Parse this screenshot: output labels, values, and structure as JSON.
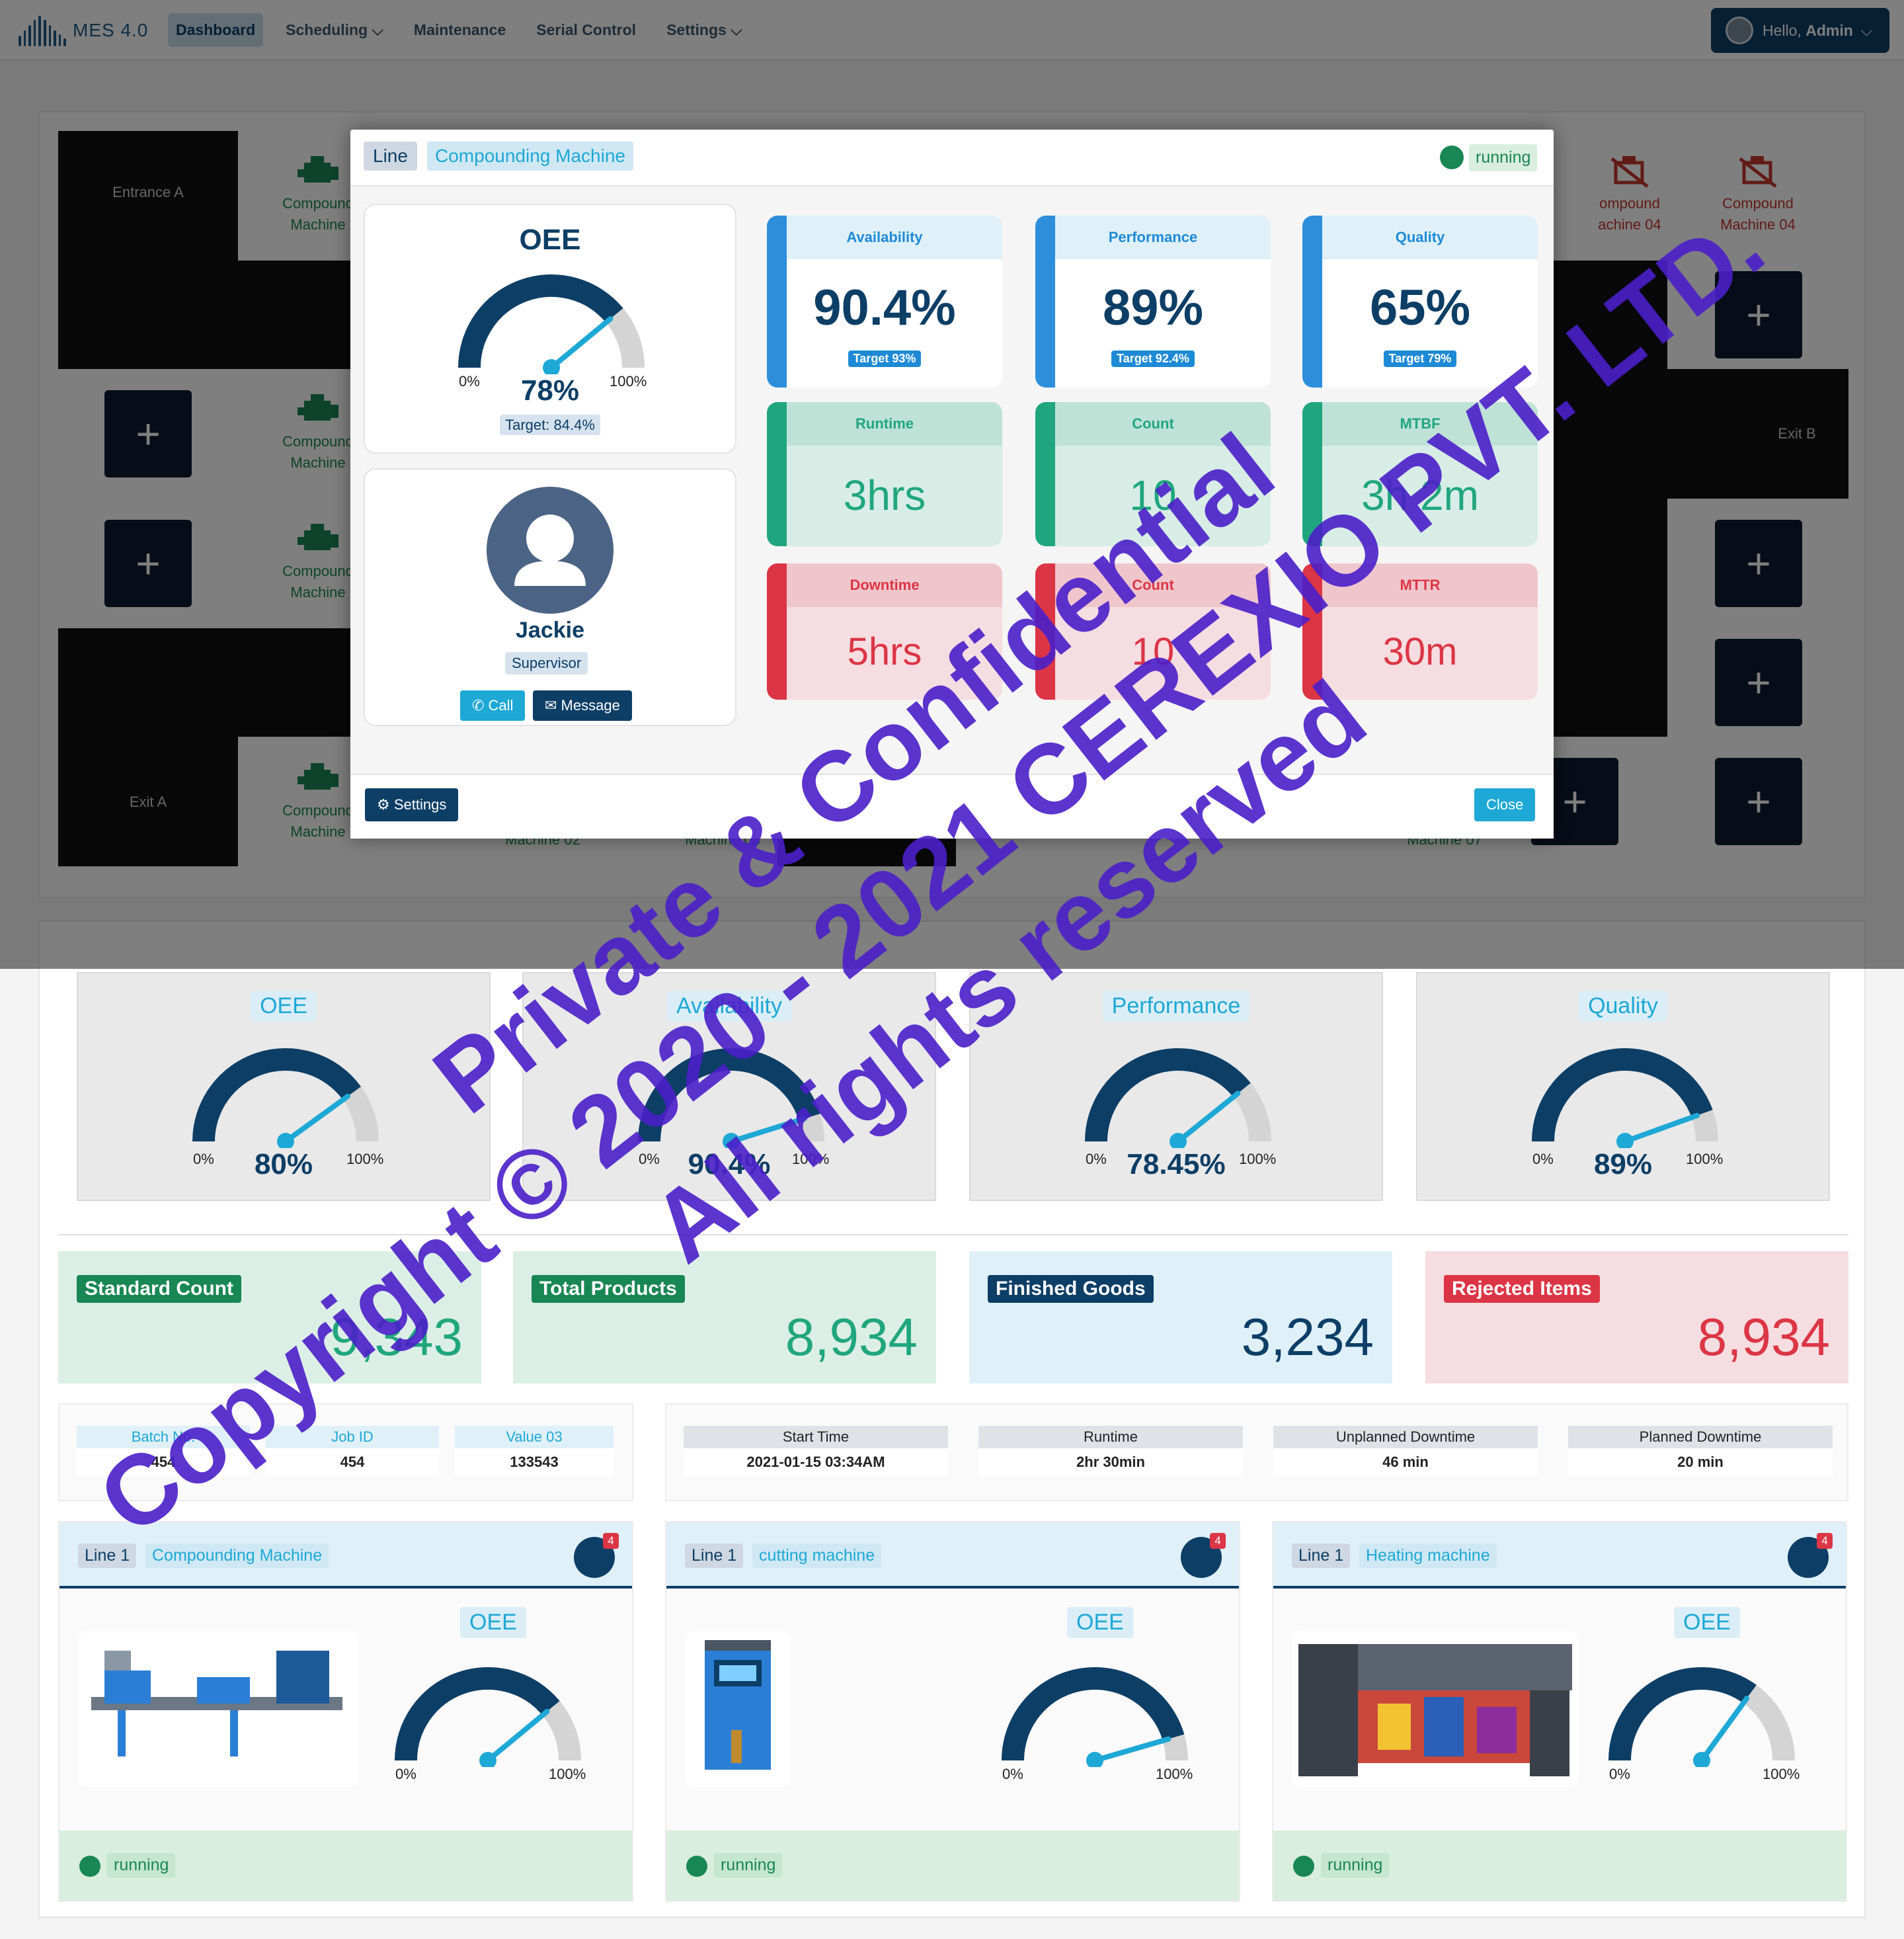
{
  "app": {
    "name": "MES 4.0"
  },
  "nav": {
    "items": [
      {
        "label": "Dashboard",
        "active": true
      },
      {
        "label": "Scheduling ⌵",
        "active": false
      },
      {
        "label": "Maintenance",
        "active": false
      },
      {
        "label": "Serial Control",
        "active": false
      },
      {
        "label": "Settings ⌵",
        "active": false
      }
    ],
    "user_prefix": "Hello, ",
    "user_name": "Admin"
  },
  "floor": {
    "zones": {
      "entrance_a": "Entrance A",
      "exit_a": "Exit A",
      "exit_b": "Exit B"
    },
    "machines": {
      "left_1": "Compound Machine",
      "left_2": "Compound Machine",
      "left_3": "Compound Machine",
      "left_4": "Compound Machine",
      "right_partial": "ompound achine 04",
      "right_full": "Compound Machine 04",
      "bottom_2": "Machine 02",
      "bottom_3": "Machine 03",
      "bottom_6": "Machine 07"
    },
    "add_label": "+"
  },
  "modal": {
    "line": "Line",
    "machine": "Compounding Machine",
    "status": "running",
    "oee": {
      "title": "OEE",
      "value": "78%",
      "value_num": 78,
      "target": "Target: 84.4%",
      "min": "0%",
      "max": "100%"
    },
    "person": {
      "name": "Jackie",
      "role": "Supervisor",
      "call": "Call",
      "message": "Message"
    },
    "metrics": [
      {
        "label": "Availability",
        "value": "90.4%",
        "target": "Target 93%"
      },
      {
        "label": "Performance",
        "value": "89%",
        "target": "Target 92.4%"
      },
      {
        "label": "Quality",
        "value": "65%",
        "target": "Target 79%"
      },
      {
        "label": "Runtime",
        "value": "3hrs"
      },
      {
        "label": "Count",
        "value": "10"
      },
      {
        "label": "MTBF",
        "value": "3h 2m"
      },
      {
        "label": "Downtime",
        "value": "5hrs"
      },
      {
        "label": "Count",
        "value": "10"
      },
      {
        "label": "MTTR",
        "value": "30m"
      }
    ],
    "settings": "Settings",
    "close": "Close"
  },
  "gauges": [
    {
      "title": "OEE",
      "value": "80%",
      "value_num": 80
    },
    {
      "title": "Availability",
      "value": "90.4%",
      "value_num": 90.4
    },
    {
      "title": "Performance",
      "value": "78.45%",
      "value_num": 78.45
    },
    {
      "title": "Quality",
      "value": "89%",
      "value_num": 89
    }
  ],
  "gauge_min": "0%",
  "gauge_max": "100%",
  "counts": [
    {
      "label": "Standard Count",
      "value": "9,343"
    },
    {
      "label": "Total Products",
      "value": "8,934"
    },
    {
      "label": "Finished Goods",
      "value": "3,234"
    },
    {
      "label": "Rejected Items",
      "value": "8,934"
    }
  ],
  "batch": [
    {
      "label": "Batch No.",
      "value": "454"
    },
    {
      "label": "Job ID",
      "value": "454"
    },
    {
      "label": "Value 03",
      "value": "133543"
    }
  ],
  "times": [
    {
      "label": "Start Time",
      "value": "2021-01-15 03:34AM"
    },
    {
      "label": "Runtime",
      "value": "2hr 30min"
    },
    {
      "label": "Unplanned Downtime",
      "value": "46 min"
    },
    {
      "label": "Planned Downtime",
      "value": "20 min"
    }
  ],
  "machine_cards": [
    {
      "line": "Line 1",
      "name": "Compounding Machine",
      "alerts": "4",
      "oee_title": "OEE",
      "oee_num": 78,
      "status": "running"
    },
    {
      "line": "Line 1",
      "name": "cutting machine",
      "alerts": "4",
      "oee_title": "OEE",
      "oee_num": 91,
      "status": "running"
    },
    {
      "line": "Line 1",
      "name": "Heating machine",
      "alerts": "4",
      "oee_title": "OEE",
      "oee_num": 70,
      "status": "running"
    }
  ],
  "watermark": {
    "line1": "Private & Confidential",
    "line2": "Copyright © 2020 - 2021 CEREXIO PVT. LTD.",
    "line3": "All rights reserved"
  },
  "colors": {
    "navy": "#0d3e66",
    "cyan": "#1ea8d6",
    "green": "#198754",
    "red": "#dc3545",
    "watermark": "#4b1fc9"
  }
}
